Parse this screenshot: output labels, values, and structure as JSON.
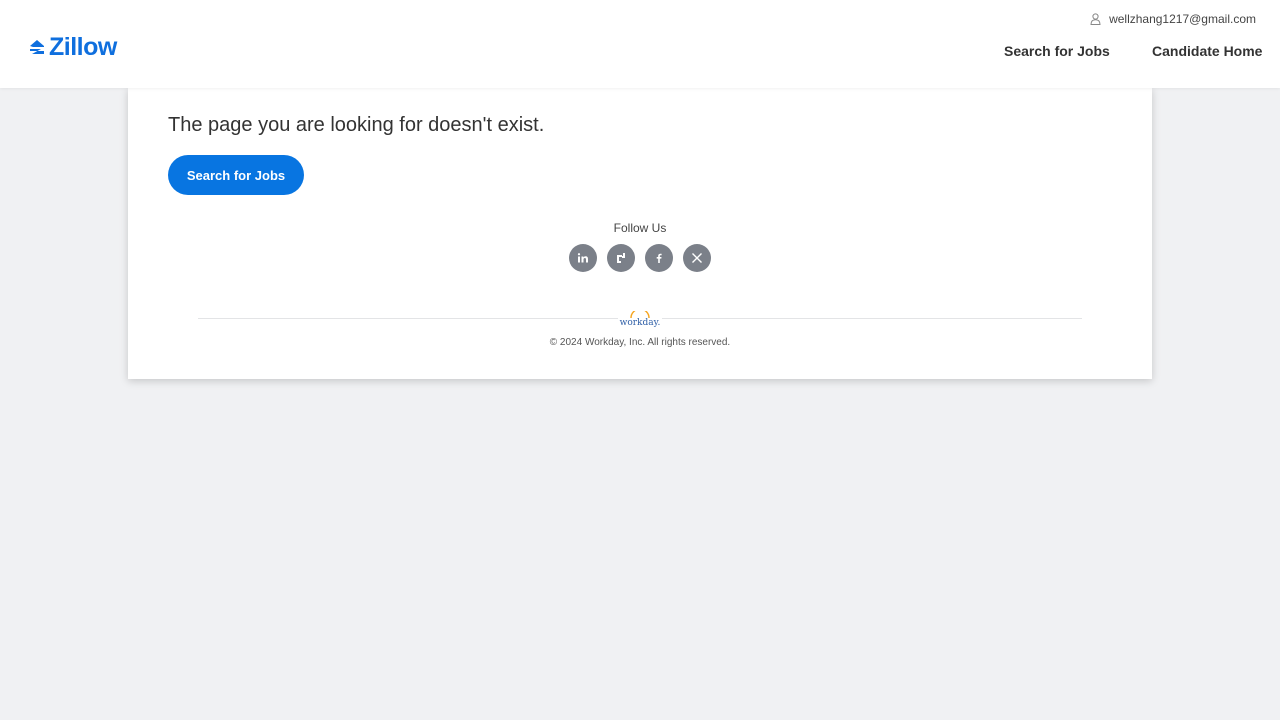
{
  "header": {
    "logo_text": "Zillow",
    "user_email": "wellzhang1217@gmail.com",
    "nav": {
      "search_jobs": "Search for Jobs",
      "candidate_home": "Candidate Home"
    }
  },
  "main": {
    "message": "The page you are looking for doesn't exist.",
    "search_button": "Search for Jobs"
  },
  "footer": {
    "follow_us": "Follow Us",
    "social_icons": [
      "linkedin-icon",
      "glassdoor-icon",
      "facebook-icon",
      "x-icon"
    ],
    "workday_logo_text": "workday.",
    "copyright": "© 2024 Workday, Inc. All rights reserved."
  },
  "colors": {
    "brand": "#0f6fde",
    "button": "#0875e1",
    "background": "#f0f1f3",
    "social_icon_bg": "#7b8089"
  }
}
